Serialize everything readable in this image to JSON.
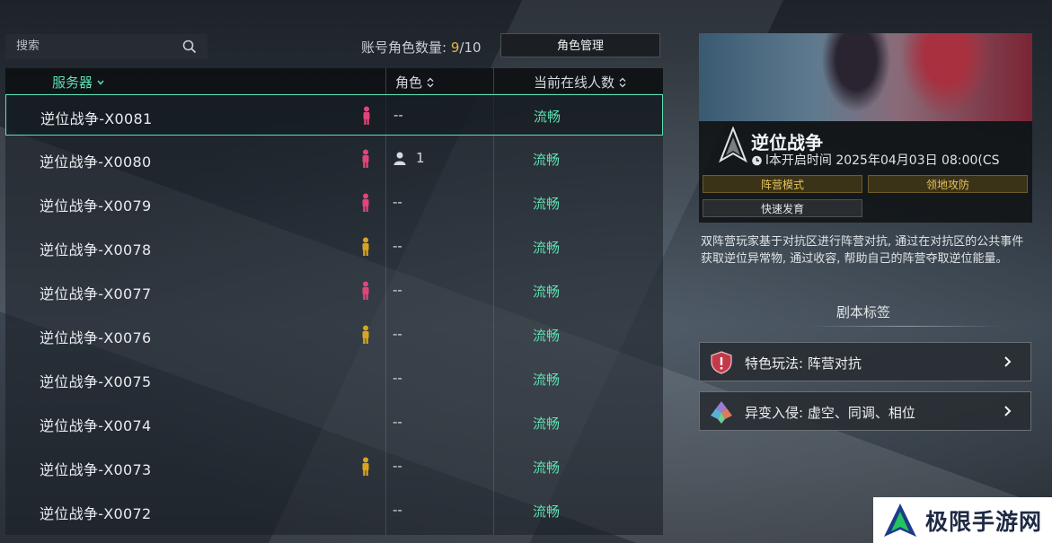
{
  "search": {
    "placeholder": "搜索"
  },
  "account": {
    "label": "账号角色数量: ",
    "current": "9",
    "separator": "/",
    "max": "10"
  },
  "manage_button": "角色管理",
  "table": {
    "headers": {
      "server": "服务器",
      "role": "角色",
      "online": "当前在线人数"
    },
    "rows": [
      {
        "name": "逆位战争-X0081",
        "figure": "pink",
        "roles": "--",
        "role_count": "",
        "status": "流畅"
      },
      {
        "name": "逆位战争-X0080",
        "figure": "pink",
        "roles": "",
        "role_count": "1",
        "status": "流畅"
      },
      {
        "name": "逆位战争-X0079",
        "figure": "pink",
        "roles": "--",
        "role_count": "",
        "status": "流畅"
      },
      {
        "name": "逆位战争-X0078",
        "figure": "yellow",
        "roles": "--",
        "role_count": "",
        "status": "流畅"
      },
      {
        "name": "逆位战争-X0077",
        "figure": "pink",
        "roles": "--",
        "role_count": "",
        "status": "流畅"
      },
      {
        "name": "逆位战争-X0076",
        "figure": "yellow",
        "roles": "--",
        "role_count": "",
        "status": "流畅"
      },
      {
        "name": "逆位战争-X0075",
        "figure": "none",
        "roles": "--",
        "role_count": "",
        "status": "流畅"
      },
      {
        "name": "逆位战争-X0074",
        "figure": "none",
        "roles": "--",
        "role_count": "",
        "status": "流畅"
      },
      {
        "name": "逆位战争-X0073",
        "figure": "yellow",
        "roles": "--",
        "role_count": "",
        "status": "流畅"
      },
      {
        "name": "逆位战争-X0072",
        "figure": "none",
        "roles": "--",
        "role_count": "",
        "status": "流畅"
      }
    ]
  },
  "detail": {
    "title": "逆位战争",
    "open_time": "l本开启时间 2025年04月03日 08:00(CS",
    "tags": [
      "阵营模式",
      "领地攻防",
      "快速发育"
    ],
    "description": "双阵营玩家基于对抗区进行阵营对抗, 通过在对抗区的公共事件获取逆位异常物, 通过收容, 帮助自己的阵营夺取逆位能量。",
    "section_title": "剧本标签",
    "features": [
      {
        "label": "特色玩法: 阵营对抗",
        "icon": "shield-alert-icon"
      },
      {
        "label": "异变入侵: 虚空、同调、相位",
        "icon": "mutation-icon"
      }
    ]
  },
  "watermark": {
    "text": "极限手游网"
  },
  "colors": {
    "accent": "#5ee0b2",
    "gold": "#e3b34a",
    "pink": "#e0457a",
    "yellow": "#d9a520"
  }
}
